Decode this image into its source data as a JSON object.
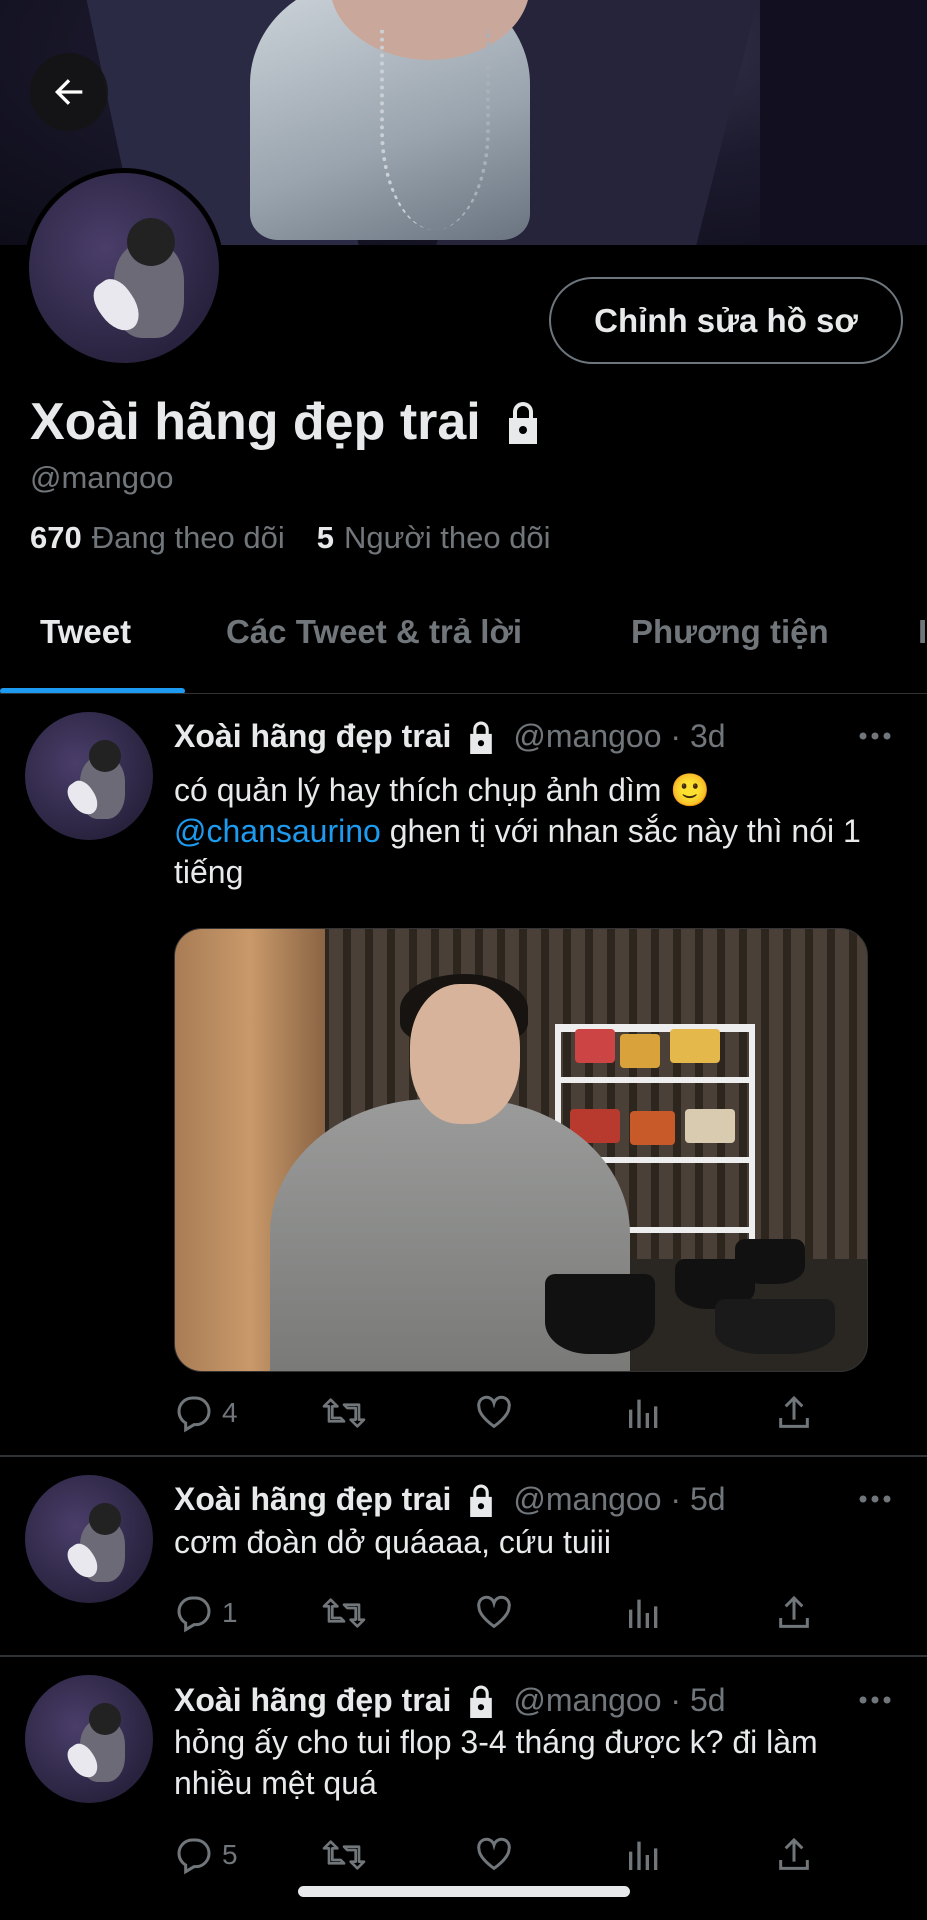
{
  "profile": {
    "display_name": "Xoài hãng đẹp trai",
    "handle": "@mangoo",
    "edit_button": "Chỉnh sửa hồ sơ",
    "following_count": "670",
    "following_label": "Đang theo dõi",
    "followers_count": "5",
    "followers_label": "Người theo dõi"
  },
  "tabs": [
    {
      "label": "Tweet",
      "active": true
    },
    {
      "label": "Các Tweet & trả lời",
      "active": false
    },
    {
      "label": "Phương tiện",
      "active": false
    }
  ],
  "tweets": [
    {
      "name": "Xoài hãng đẹp trai",
      "meta": "@mangoo · 3d",
      "text_before": "có quản lý hay thích chụp ảnh dìm 🙂",
      "mention": "@chansaurino",
      "text_after": " ghen tị với nhan sắc này thì nói 1 tiếng",
      "replies": "4"
    },
    {
      "name": "Xoài hãng đẹp trai",
      "meta": "@mangoo · 5d",
      "text": "cơm đoàn dở quáaaa, cứu tuiii",
      "replies": "1"
    },
    {
      "name": "Xoài hãng đẹp trai",
      "meta": "@mangoo · 5d",
      "text": "hỏng ấy cho tui flop 3-4 tháng được k? đi làm nhiều mệt quá",
      "replies": "5"
    }
  ],
  "icons": [
    "back-arrow-icon",
    "lock-icon",
    "more-icon",
    "reply-icon",
    "retweet-icon",
    "like-icon",
    "views-icon",
    "share-icon"
  ],
  "colors": {
    "accent": "#1d9bf0",
    "background": "#000000",
    "text": "#e7e9ea",
    "muted": "#71767b"
  }
}
